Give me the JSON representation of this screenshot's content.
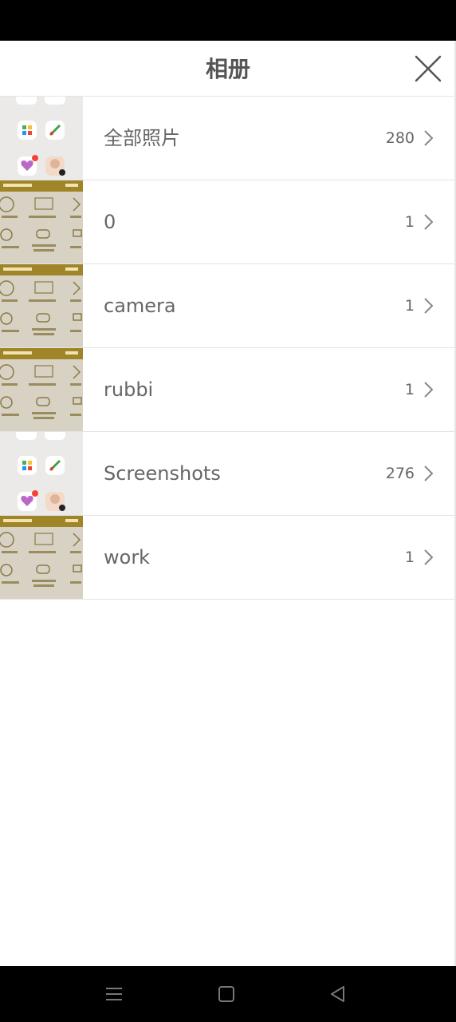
{
  "header": {
    "title": "相册"
  },
  "albums": [
    {
      "name": "全部照片",
      "count": "280",
      "thumb": "home-screen"
    },
    {
      "name": "0",
      "count": "1",
      "thumb": "laptop-box"
    },
    {
      "name": "camera",
      "count": "1",
      "thumb": "laptop-box"
    },
    {
      "name": "rubbi",
      "count": "1",
      "thumb": "laptop-box"
    },
    {
      "name": "Screenshots",
      "count": "276",
      "thumb": "home-screen"
    },
    {
      "name": "work",
      "count": "1",
      "thumb": "laptop-box"
    }
  ],
  "nav": {
    "icons": [
      "menu-icon",
      "home-square-icon",
      "back-triangle-icon"
    ]
  },
  "colors": {
    "header_text": "#555555",
    "row_text": "#666666",
    "divider": "#e3e3e3",
    "thumb_gold": "#a08428"
  }
}
